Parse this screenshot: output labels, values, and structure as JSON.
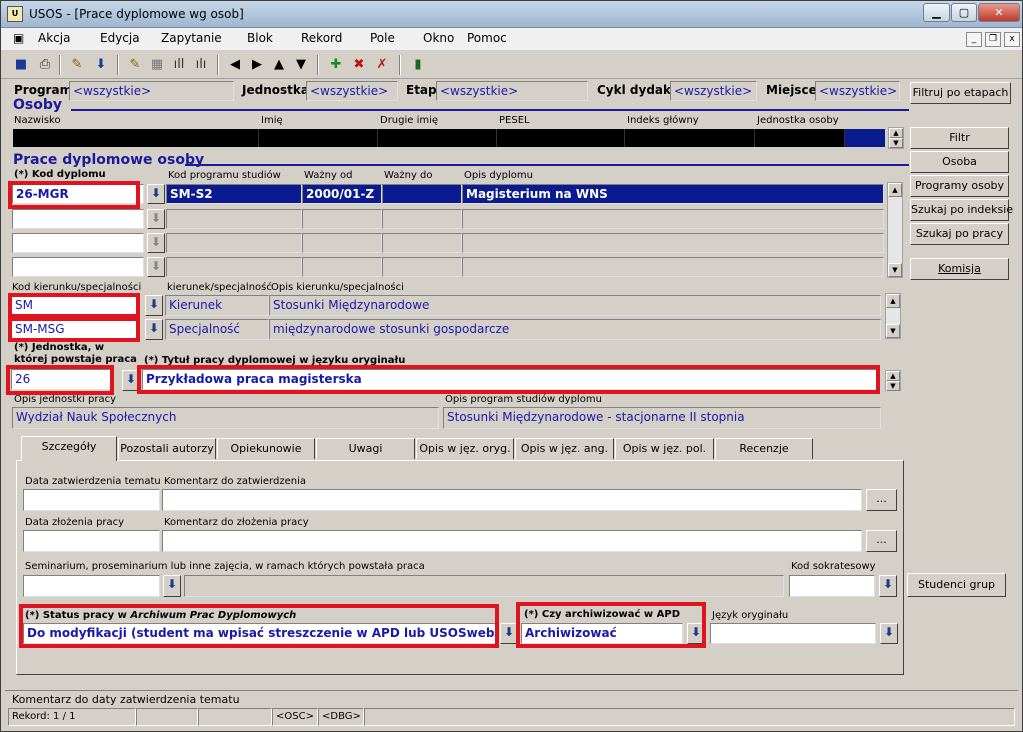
{
  "window": {
    "title": "USOS - [Prace dyplomowe wg osob]",
    "app_icon": "USOS-app-icon",
    "controls": [
      "minimize",
      "maximize",
      "close"
    ]
  },
  "menu": {
    "items": [
      "Akcja",
      "Edycja",
      "Zapytanie",
      "Blok",
      "Rekord",
      "Pole",
      "Okno",
      "Pomoc"
    ]
  },
  "toolbar": {
    "icons": [
      "save-icon",
      "print-icon",
      "edit-icon",
      "download-icon",
      "query-icon",
      "query-run-icon",
      "chart-icon",
      "chart2-icon",
      "prev-icon",
      "next-icon",
      "up-icon",
      "down-icon",
      "add-record-icon",
      "delete-record-icon",
      "clear-icon",
      "exit-icon"
    ]
  },
  "filter": {
    "program_label": "Program",
    "program_value": "<wszystkie>",
    "jednostka_label": "Jednostka",
    "jednostka_value": "<wszystkie>",
    "etap_label": "Etap",
    "etap_value": "<wszystkie>",
    "cykl_label": "Cykl dydakt.",
    "cykl_value": "<wszystkie>",
    "miejsce_label": "Miejsce",
    "miejsce_value": "<wszystkie>",
    "filter_button": "Filtruj po etapach"
  },
  "osoby": {
    "header": "Osoby",
    "columns": [
      "Nazwisko",
      "Imię",
      "Drugie imię",
      "PESEL",
      "Indeks główny",
      "Jednostka osoby"
    ]
  },
  "prace": {
    "header": "Prace dyplomowe osoby",
    "col_kod": "(*) Kod dyplomu",
    "col_kod_programu": "Kod programu studiów",
    "col_wazny_od": "Ważny od",
    "col_wazny_do": "Ważny do",
    "col_opis": "Opis dyplomu",
    "rows": [
      {
        "kod": "26-MGR",
        "kod_programu": "SM-S2",
        "wazny_od": "2000/01-Z",
        "wazny_do": "",
        "opis": "Magisterium na WNS"
      },
      {
        "kod": "",
        "kod_programu": "",
        "wazny_od": "",
        "wazny_do": "",
        "opis": ""
      },
      {
        "kod": "",
        "kod_programu": "",
        "wazny_od": "",
        "wazny_do": "",
        "opis": ""
      },
      {
        "kod": "",
        "kod_programu": "",
        "wazny_od": "",
        "wazny_do": "",
        "opis": ""
      }
    ]
  },
  "kierunek": {
    "col_kod": "Kod kierunku/specjalności",
    "col_typ": "kierunek/specjalność",
    "col_opis": "Opis kierunku/specjalności",
    "rows": [
      {
        "kod": "SM",
        "typ": "Kierunek",
        "opis": "Stosunki Międzynarodowe"
      },
      {
        "kod": "SM-MSG",
        "typ": "Specjalność",
        "opis": "międzynarodowe stosunki gospodarcze"
      }
    ]
  },
  "jednostka": {
    "label_line1": "(*) Jednostka, w",
    "label_line2": "której powstaje praca",
    "value": "26",
    "opis_label": "Opis jednostki pracy",
    "opis_value": "Wydział Nauk Społecznych"
  },
  "tytul": {
    "label": "(*) Tytuł pracy dyplomowej w języku oryginału",
    "value": "Przykładowa praca magisterska"
  },
  "program_opis": {
    "label": "Opis program studiów dyplomu",
    "value": "Stosunki Międzynarodowe - stacjonarne II stopnia"
  },
  "side_buttons": {
    "filtr": "Filtr",
    "osoba": "Osoba",
    "programy": "Programy osoby",
    "szukaj_indeks": "Szukaj po indeksie",
    "szukaj_praca": "Szukaj po pracy",
    "komisja": "Komisja",
    "studenci_grup": "Studenci grup"
  },
  "tabs": [
    "Szczegóły",
    "Pozostali autorzy",
    "Opiekunowie",
    "Uwagi",
    "Opis w jęz. oryg.",
    "Opis w jęz. ang.",
    "Opis w jęz. pol.",
    "Recenzje"
  ],
  "details": {
    "data_zatw_label": "Data zatwierdzenia tematu",
    "data_zatw_value": "",
    "kom_zatw_label": "Komentarz do zatwierdzenia",
    "kom_zatw_value": "",
    "data_zloz_label": "Data złożenia pracy",
    "data_zloz_value": "",
    "kom_zloz_label": "Komentarz do złożenia pracy",
    "kom_zloz_value": "",
    "seminarium_label": "Seminarium, proseminarium lub inne zajęcia, w ramach których powstała praca",
    "seminarium_value": "",
    "sokrates_label": "Kod sokratesowy",
    "sokrates_value": "",
    "status_label_a": "(*) Status pracy w ",
    "status_label_b": "Archiwum Prac Dyplomowych",
    "status_value": "Do modyfikacji (student ma wpisać streszczenie w APD lub USOSweb)",
    "archiwizowac_label": "(*) Czy archiwizować w APD",
    "archiwizowac_value": "Archiwizować",
    "jezyk_label": "Język oryginału",
    "jezyk_value": "",
    "ellipsis": "..."
  },
  "status": {
    "hint": "Komentarz do daty zatwierdzenia tematu",
    "record": "Rekord: 1 / 1",
    "osc": "<OSC>",
    "dbg": "<DBG>"
  },
  "colors": {
    "highlight": "#e0141e",
    "selected_row": "#0a1b8f",
    "field_text": "#1a1aaa",
    "header_text": "#1a1a9a"
  }
}
